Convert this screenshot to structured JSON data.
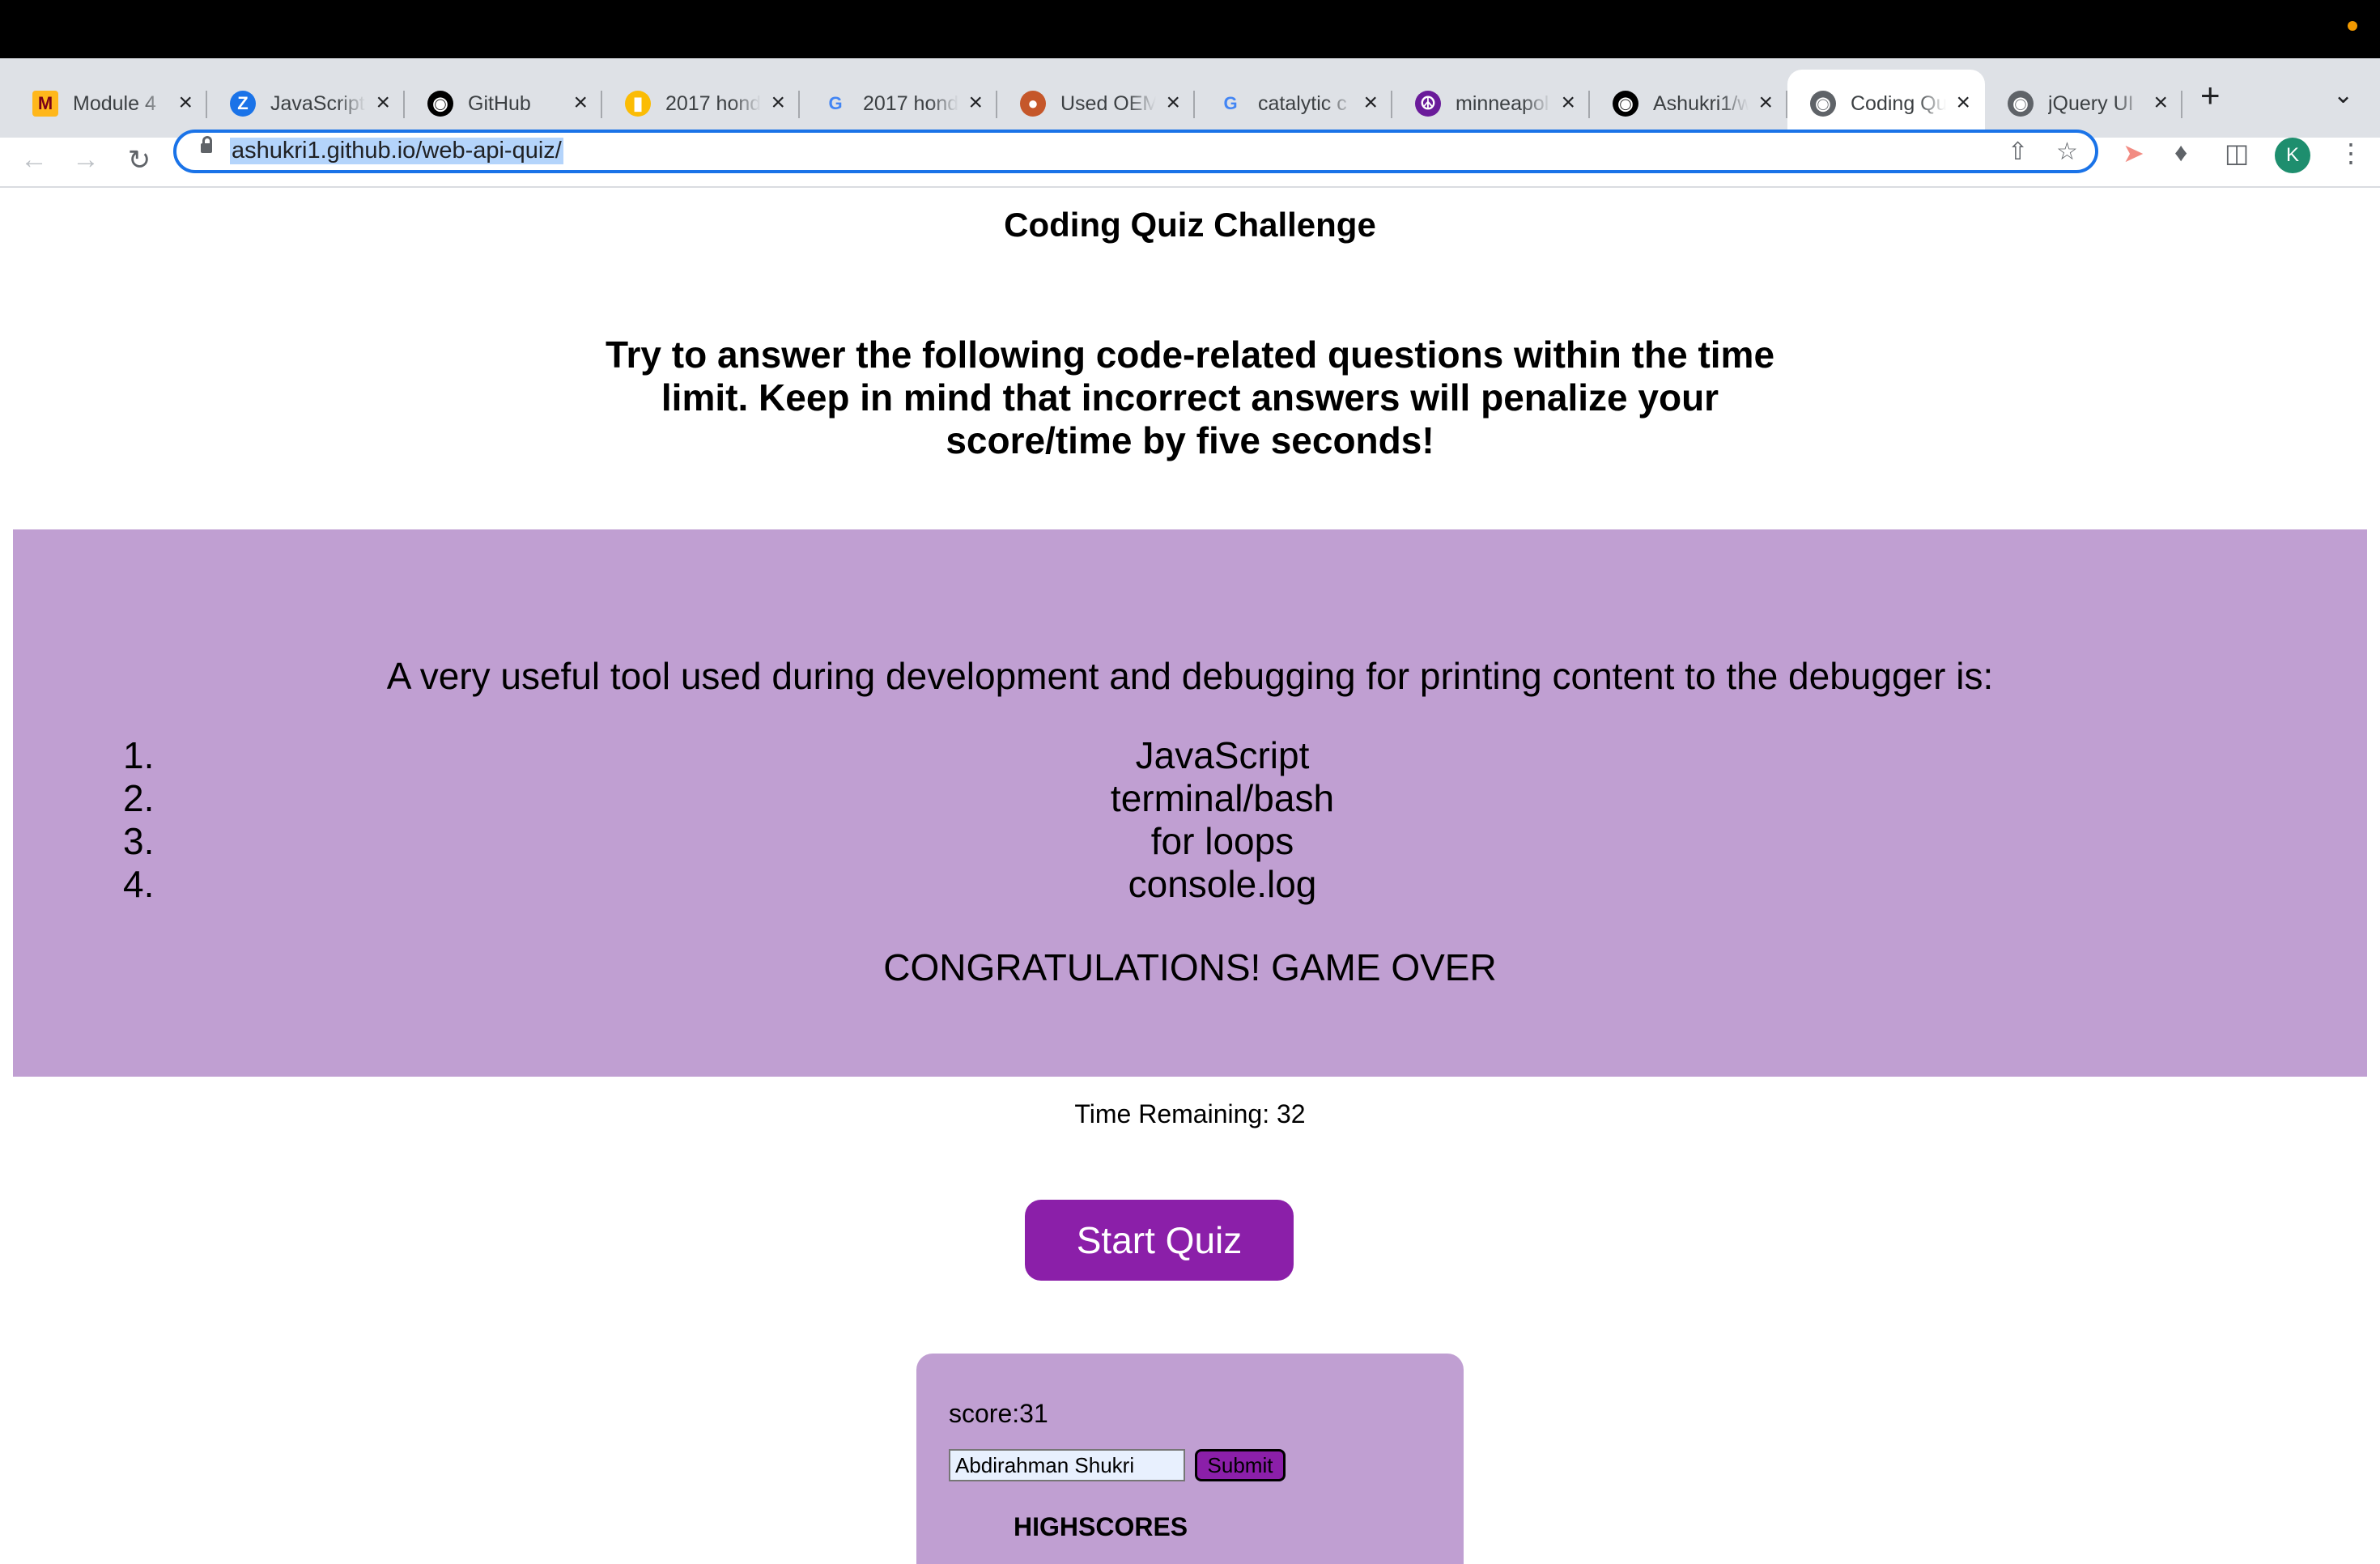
{
  "tabs": [
    {
      "title": "Module 4",
      "icon": "university-logo-icon",
      "color": "#ffb71b"
    },
    {
      "title": "JavaScript",
      "icon": "z-logo-icon",
      "color": "#1a73e8"
    },
    {
      "title": "GitHub",
      "icon": "github-icon",
      "color": "#000000"
    },
    {
      "title": "2017 hond",
      "icon": "shopping-bag-icon",
      "color": "#fbbc04"
    },
    {
      "title": "2017 hond",
      "icon": "google-icon",
      "color": "#4285f4"
    },
    {
      "title": "Used OEM",
      "icon": "parts-store-icon",
      "color": "#c5572a"
    },
    {
      "title": "catalytic c",
      "icon": "google-icon",
      "color": "#4285f4"
    },
    {
      "title": "minneapol",
      "icon": "peace-sign-icon",
      "color": "#6a1b9a"
    },
    {
      "title": "Ashukri1/w",
      "icon": "github-icon",
      "color": "#000000"
    },
    {
      "title": "Coding Qu",
      "icon": "globe-icon",
      "color": "#5f6368",
      "active": true
    },
    {
      "title": "jQuery UI",
      "icon": "globe-icon",
      "color": "#5f6368"
    }
  ],
  "browser": {
    "url": "ashukri1.github.io/web-api-quiz/",
    "avatar_letter": "K"
  },
  "page": {
    "title": "Coding Quiz Challenge",
    "intro": "Try to answer the following code-related questions within the time limit. Keep in mind that incorrect answers will penalize your score/time by five seconds!",
    "question": "A very useful tool used during development and debugging for printing content to the debugger is:",
    "choices": [
      {
        "num": "1.",
        "text": "JavaScript"
      },
      {
        "num": "2.",
        "text": "terminal/bash"
      },
      {
        "num": "3.",
        "text": "for loops"
      },
      {
        "num": "4.",
        "text": "console.log"
      }
    ],
    "game_over": "CONGRATULATIONS! GAME OVER",
    "timer": "Time Remaining: 32",
    "start_label": "Start Quiz",
    "score": "score:31",
    "name_value": "Abdirahman Shukri",
    "submit_label": "Submit",
    "highscores": "HIGHSCORES"
  },
  "colors": {
    "accent": "#8b1fa9",
    "panel": "#c09fd2"
  }
}
